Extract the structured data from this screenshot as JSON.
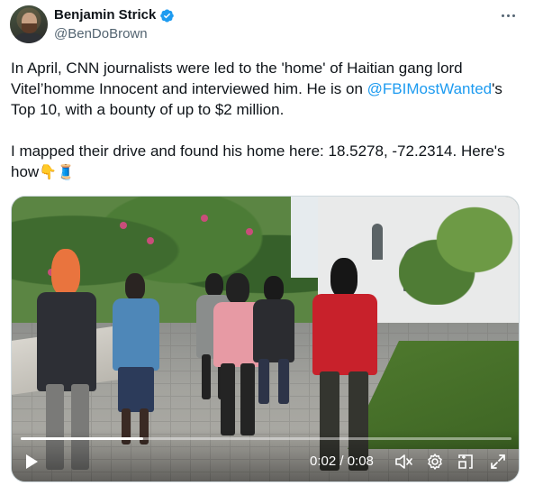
{
  "author": {
    "display_name": "Benjamin Strick",
    "handle": "@BenDoBrown",
    "verified": true,
    "avatar_icon": "avatar"
  },
  "tweet": {
    "line1_before": "In April, CNN journalists were led to the 'home' of Haitian gang lord Vitel’homme Innocent and interviewed him. He is on ",
    "mention": "@FBIMostWanted",
    "line1_after": "'s Top 10, with a bounty of up to $2 million.",
    "line2_text": "I mapped their drive and found his home here: 18.5278, -72.2314. Here's how",
    "line2_emoji": "👇🧵"
  },
  "video": {
    "time_display": "0:02 / 0:08",
    "progress_fraction": 0.25,
    "controls": [
      "play-icon",
      "volume-muted-icon",
      "settings-gear-icon",
      "picture-in-picture-icon",
      "fullscreen-icon"
    ]
  },
  "colors": {
    "text": "#0f1419",
    "secondary": "#536471",
    "link": "#1d9bf0",
    "verified": "#1d9bf0"
  }
}
